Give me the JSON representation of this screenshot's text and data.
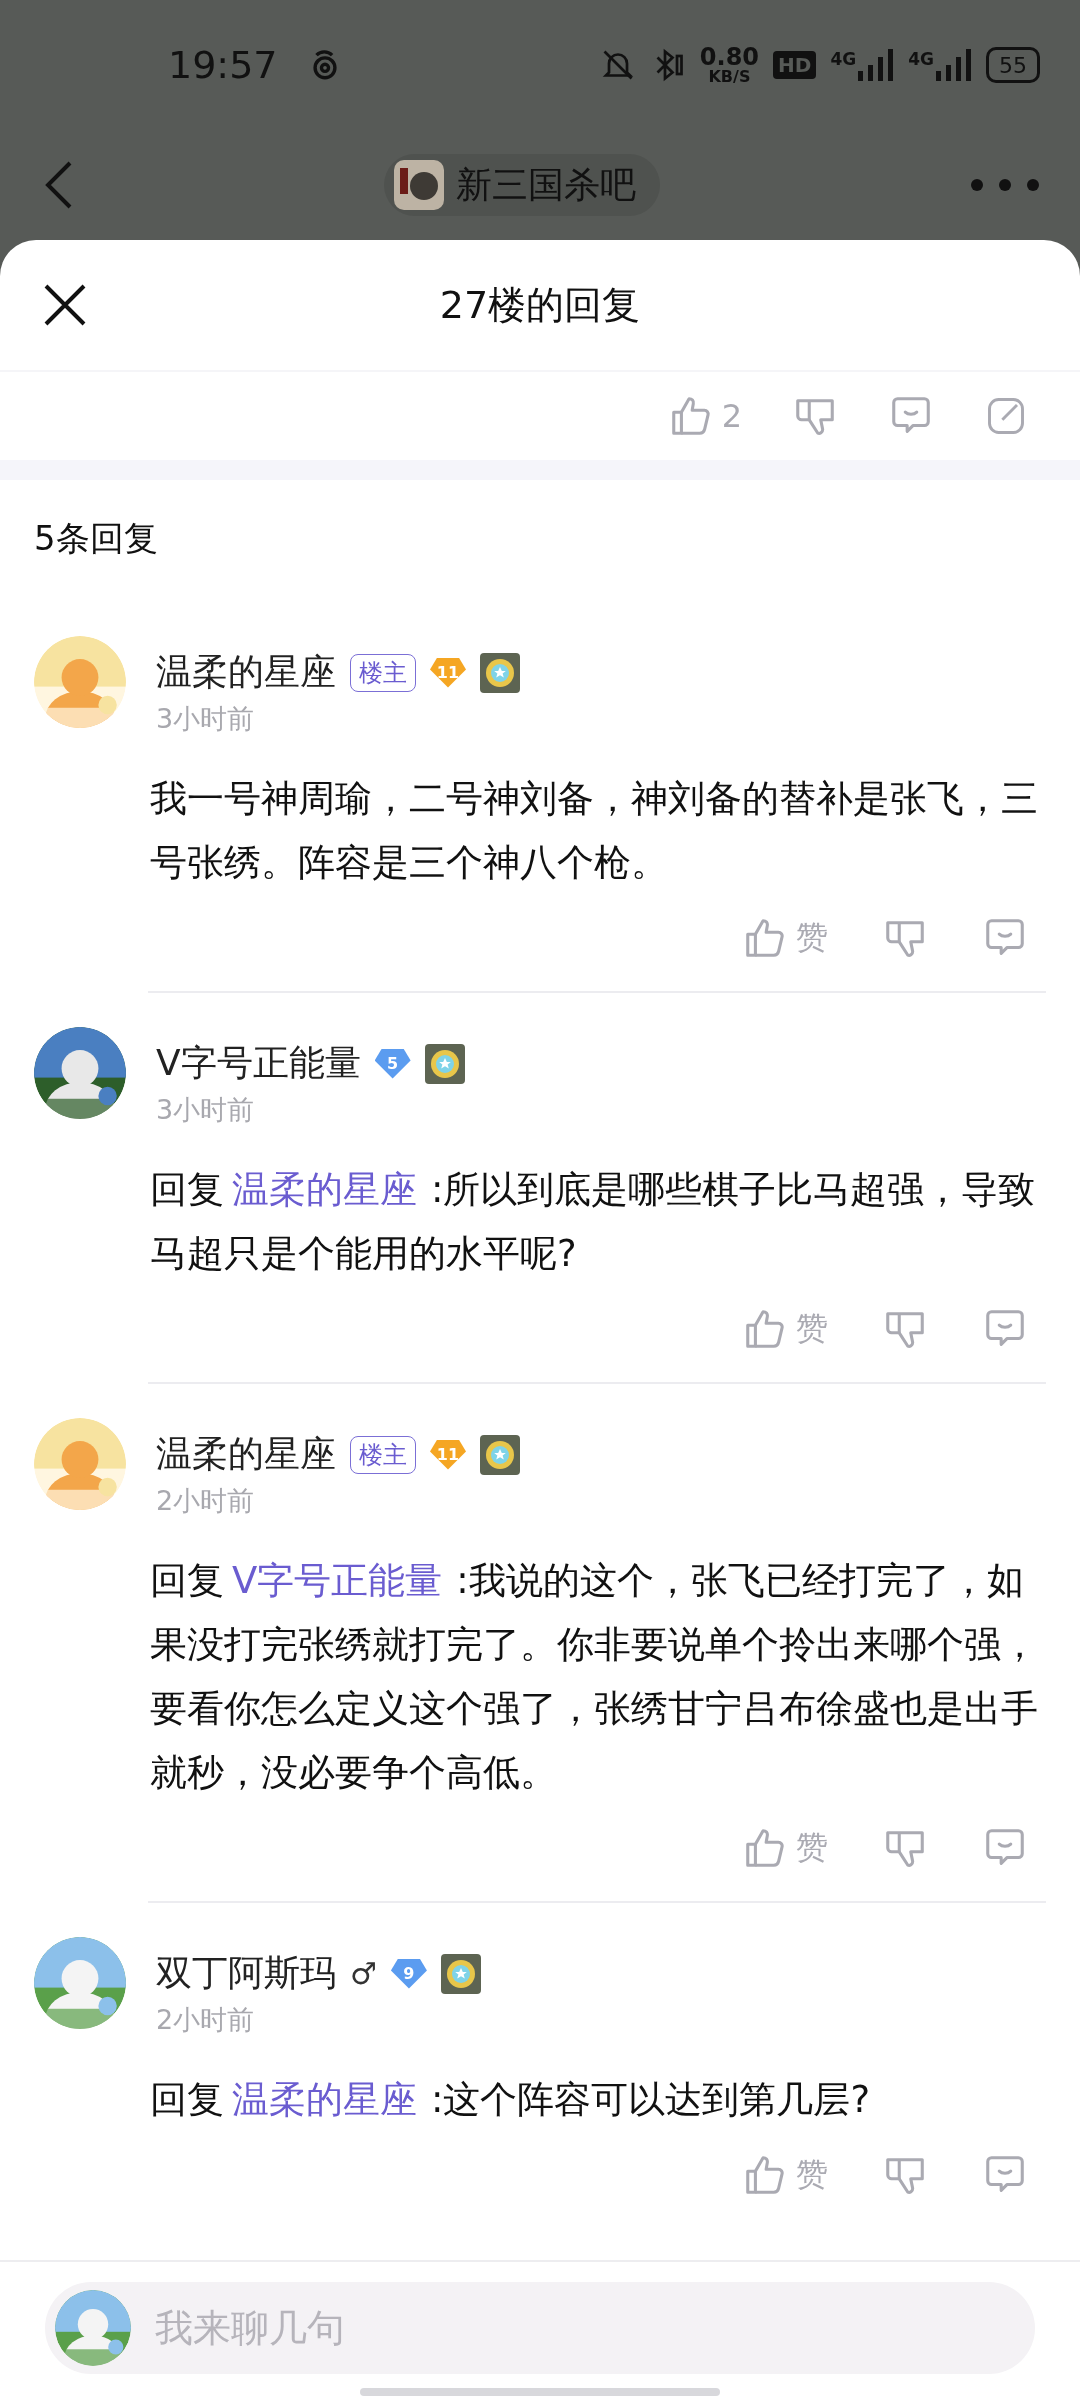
{
  "status_bar": {
    "time": "19:57",
    "net_speed": "0.80",
    "net_unit": "KB/S",
    "hd": "HD",
    "sim1": "4G",
    "sim2": "4G",
    "battery": "55"
  },
  "nav": {
    "forum": "新三国杀吧"
  },
  "sheet": {
    "title": "27楼的回复",
    "like_count": "2"
  },
  "reply_count": "5条回复",
  "comments": [
    {
      "name": "温柔的星座",
      "op_tag": "楼主",
      "level": {
        "text": "11",
        "color": "#f5a623"
      },
      "time": "3小时前",
      "text": "我一号神周瑜，二号神刘备，神刘备的替补是张飞，三号张绣。阵容是三个神八个枪。",
      "like_label": "赞"
    },
    {
      "name": "V字号正能量",
      "level": {
        "text": "5",
        "color": "#5b9cf0"
      },
      "time": "3小时前",
      "reply_prefix": "回复",
      "reply_to": "温柔的星座",
      "text": ":所以到底是哪些棋子比马超强，导致马超只是个能用的水平呢?",
      "like_label": "赞"
    },
    {
      "name": "温柔的星座",
      "op_tag": "楼主",
      "level": {
        "text": "11",
        "color": "#f5a623"
      },
      "time": "2小时前",
      "reply_prefix": "回复",
      "reply_to": "V字号正能量",
      "text": ":我说的这个，张飞已经打完了，如果没打完张绣就打完了。你非要说单个拎出来哪个强，要看你怎么定义这个强了，张绣甘宁吕布徐盛也是出手就秒，没必要争个高低。",
      "like_label": "赞"
    },
    {
      "name": "双丁阿斯玛",
      "gender": "♂",
      "level": {
        "text": "9",
        "color": "#5b9cf0"
      },
      "time": "2小时前",
      "reply_prefix": "回复",
      "reply_to": "温柔的星座",
      "text": ":这个阵容可以达到第几层?",
      "like_label": "赞"
    }
  ],
  "composer": {
    "placeholder": "我来聊几句"
  }
}
